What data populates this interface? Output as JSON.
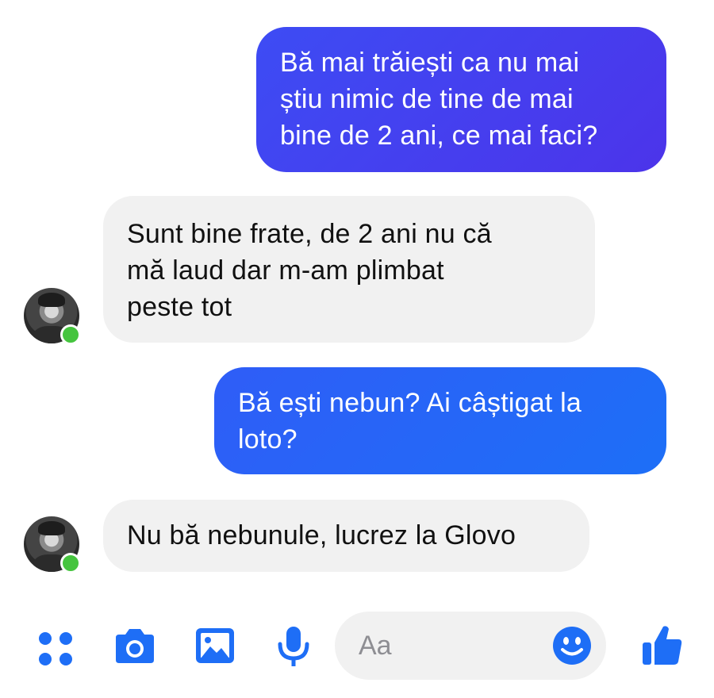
{
  "messages": [
    {
      "direction": "outgoing",
      "lines": [
        "Bă mai trăiești ca nu mai",
        "știu nimic de tine de mai",
        "bine de 2 ani, ce mai faci?"
      ]
    },
    {
      "direction": "incoming",
      "lines": [
        "Sunt bine frate, de 2 ani nu că",
        "mă laud dar m-am plimbat",
        "peste tot"
      ]
    },
    {
      "direction": "outgoing",
      "lines": [
        "Bă ești nebun? Ai câștigat la",
        "loto?"
      ]
    },
    {
      "direction": "incoming",
      "lines": [
        "Nu bă nebunule, lucrez la Glovo"
      ]
    }
  ],
  "composer": {
    "placeholder": "Aa"
  },
  "toolbar": {
    "icons": [
      "apps-icon",
      "camera-icon",
      "gallery-icon",
      "microphone-icon",
      "emoji-icon",
      "thumbs-up-icon"
    ]
  },
  "colors": {
    "accent": "#1e6ef6",
    "outgoing_bubble_1": "#4640ee",
    "outgoing_bubble_2": "#2466f7",
    "incoming_bubble": "#f1f1f1",
    "online": "#45c43e"
  }
}
